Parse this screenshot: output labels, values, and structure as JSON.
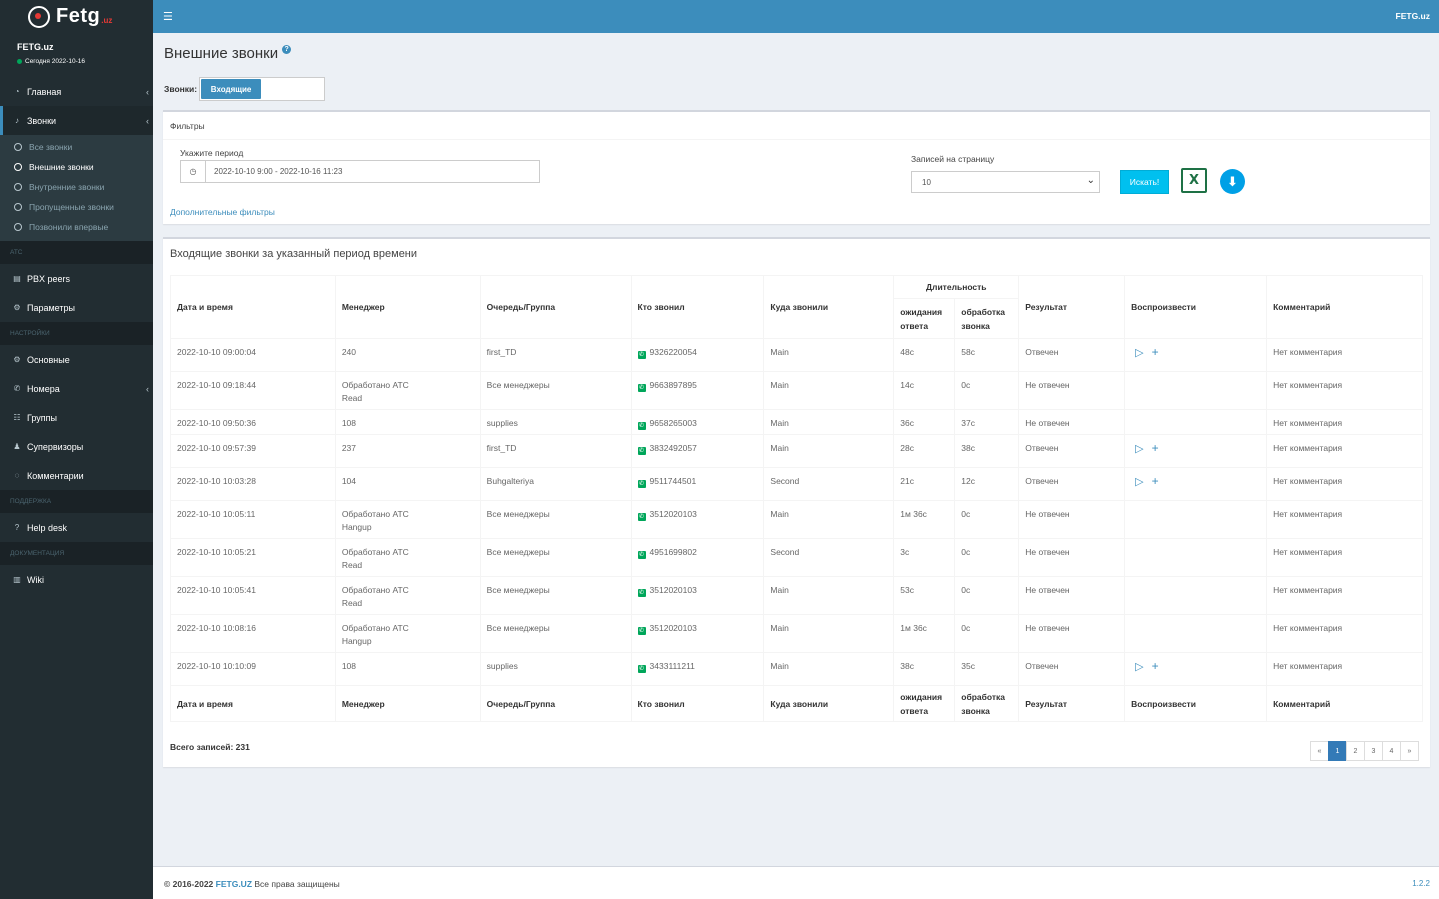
{
  "brand": {
    "logo_text": "Fetg",
    "logo_suffix": ".uz",
    "top_right": "FETG.uz"
  },
  "user": {
    "name": "FETG.uz",
    "status": "Сегодня 2022-10-16",
    "status_color": "#00a65a"
  },
  "sidebar": {
    "main": {
      "label": "Главная",
      "icon": "dashboard-icon"
    },
    "calls": {
      "label": "Звонки",
      "icon": "bell-icon"
    },
    "calls_sub": [
      {
        "label": "Все звонки"
      },
      {
        "label": "Внешние звонки"
      },
      {
        "label": "Внутренние звонки"
      },
      {
        "label": "Пропущенные звонки"
      },
      {
        "label": "Позвонили впервые"
      }
    ],
    "header_atc": "АТС",
    "pbx": {
      "label": "PBX peers"
    },
    "params": {
      "label": "Параметры"
    },
    "header_settings": "НАСТРОЙКИ",
    "basic": {
      "label": "Основные"
    },
    "numbers": {
      "label": "Номера"
    },
    "groups": {
      "label": "Группы"
    },
    "supervisors": {
      "label": "Супервизоры"
    },
    "comments": {
      "label": "Комментарии"
    },
    "header_support": "ПОДДЕРЖКА",
    "helpdesk": {
      "label": "Help desk"
    },
    "header_docs": "ДОКУМЕНТАЦИЯ",
    "wiki": {
      "label": "Wiki"
    }
  },
  "page": {
    "title": "Внешние звонки",
    "calls_label": "Звонки:",
    "toggle_label": "Входящие"
  },
  "filters": {
    "title": "Фильтры",
    "period_label": "Укажите период",
    "period_value": "2022-10-10 9:00 - 2022-10-16 11:23",
    "per_page_label": "Записей на страницу",
    "per_page_value": "10",
    "search_button": "Искать!",
    "extra_filters": "Дополнительные фильтры"
  },
  "table": {
    "title": "Входящие звонки за указанный период времени",
    "headers": {
      "datetime": "Дата и время",
      "manager": "Менеджер",
      "queue": "Очередь/Группа",
      "caller": "Кто звонил",
      "dest": "Куда звонили",
      "duration": "Длительность",
      "wait": "ожидания ответа",
      "proc": "обработка звонка",
      "result": "Результат",
      "play": "Воспроизвести",
      "comment": "Комментарий"
    },
    "rows": [
      {
        "datetime": "2022-10-10 09:00:04",
        "manager": "240",
        "manager2": "",
        "queue": "first_TD",
        "caller": "9326220054",
        "dest": "Main",
        "wait": "48с",
        "proc": "58с",
        "result": "Отвечен",
        "playable": true,
        "comment": "Нет комментария"
      },
      {
        "datetime": "2022-10-10 09:18:44",
        "manager": "Обработано АТС",
        "manager2": "Read",
        "queue": "Все менеджеры",
        "caller": "9663897895",
        "dest": "Main",
        "wait": "14с",
        "proc": "0с",
        "result": "Не отвечен",
        "playable": false,
        "comment": "Нет комментария"
      },
      {
        "datetime": "2022-10-10 09:50:36",
        "manager": "108",
        "manager2": "",
        "queue": "supplies",
        "caller": "9658265003",
        "dest": "Main",
        "wait": "36с",
        "proc": "37с",
        "result": "Не отвечен",
        "playable": false,
        "comment": "Нет комментария"
      },
      {
        "datetime": "2022-10-10 09:57:39",
        "manager": "237",
        "manager2": "",
        "queue": "first_TD",
        "caller": "3832492057",
        "dest": "Main",
        "wait": "28с",
        "proc": "38с",
        "result": "Отвечен",
        "playable": true,
        "comment": "Нет комментария"
      },
      {
        "datetime": "2022-10-10 10:03:28",
        "manager": "104",
        "manager2": "",
        "queue": "Buhgalteriya",
        "caller": "9511744501",
        "dest": "Second",
        "wait": "21с",
        "proc": "12с",
        "result": "Отвечен",
        "playable": true,
        "comment": "Нет комментария"
      },
      {
        "datetime": "2022-10-10 10:05:11",
        "manager": "Обработано АТС",
        "manager2": "Hangup",
        "queue": "Все менеджеры",
        "caller": "3512020103",
        "dest": "Main",
        "wait": "1м 36с",
        "proc": "0с",
        "result": "Не отвечен",
        "playable": false,
        "comment": "Нет комментария"
      },
      {
        "datetime": "2022-10-10 10:05:21",
        "manager": "Обработано АТС",
        "manager2": "Read",
        "queue": "Все менеджеры",
        "caller": "4951699802",
        "dest": "Second",
        "wait": "3с",
        "proc": "0с",
        "result": "Не отвечен",
        "playable": false,
        "comment": "Нет комментария"
      },
      {
        "datetime": "2022-10-10 10:05:41",
        "manager": "Обработано АТС",
        "manager2": "Read",
        "queue": "Все менеджеры",
        "caller": "3512020103",
        "dest": "Main",
        "wait": "53с",
        "proc": "0с",
        "result": "Не отвечен",
        "playable": false,
        "comment": "Нет комментария"
      },
      {
        "datetime": "2022-10-10 10:08:16",
        "manager": "Обработано АТС",
        "manager2": "Hangup",
        "queue": "Все менеджеры",
        "caller": "3512020103",
        "dest": "Main",
        "wait": "1м 36с",
        "proc": "0с",
        "result": "Не отвечен",
        "playable": false,
        "comment": "Нет комментария"
      },
      {
        "datetime": "2022-10-10 10:10:09",
        "manager": "108",
        "manager2": "",
        "queue": "supplies",
        "caller": "3433111211",
        "dest": "Main",
        "wait": "38с",
        "proc": "35с",
        "result": "Отвечен",
        "playable": true,
        "comment": "Нет комментария"
      }
    ]
  },
  "total": "Всего записей: 231",
  "pagination": {
    "prev": "«",
    "pages": [
      "1",
      "2",
      "3",
      "4"
    ],
    "active": "1",
    "next": "»"
  },
  "footer": {
    "copyright": "© 2016-2022",
    "brand": "FETG.UZ",
    "rights": "Все права защищены",
    "version": "1.2.2"
  }
}
